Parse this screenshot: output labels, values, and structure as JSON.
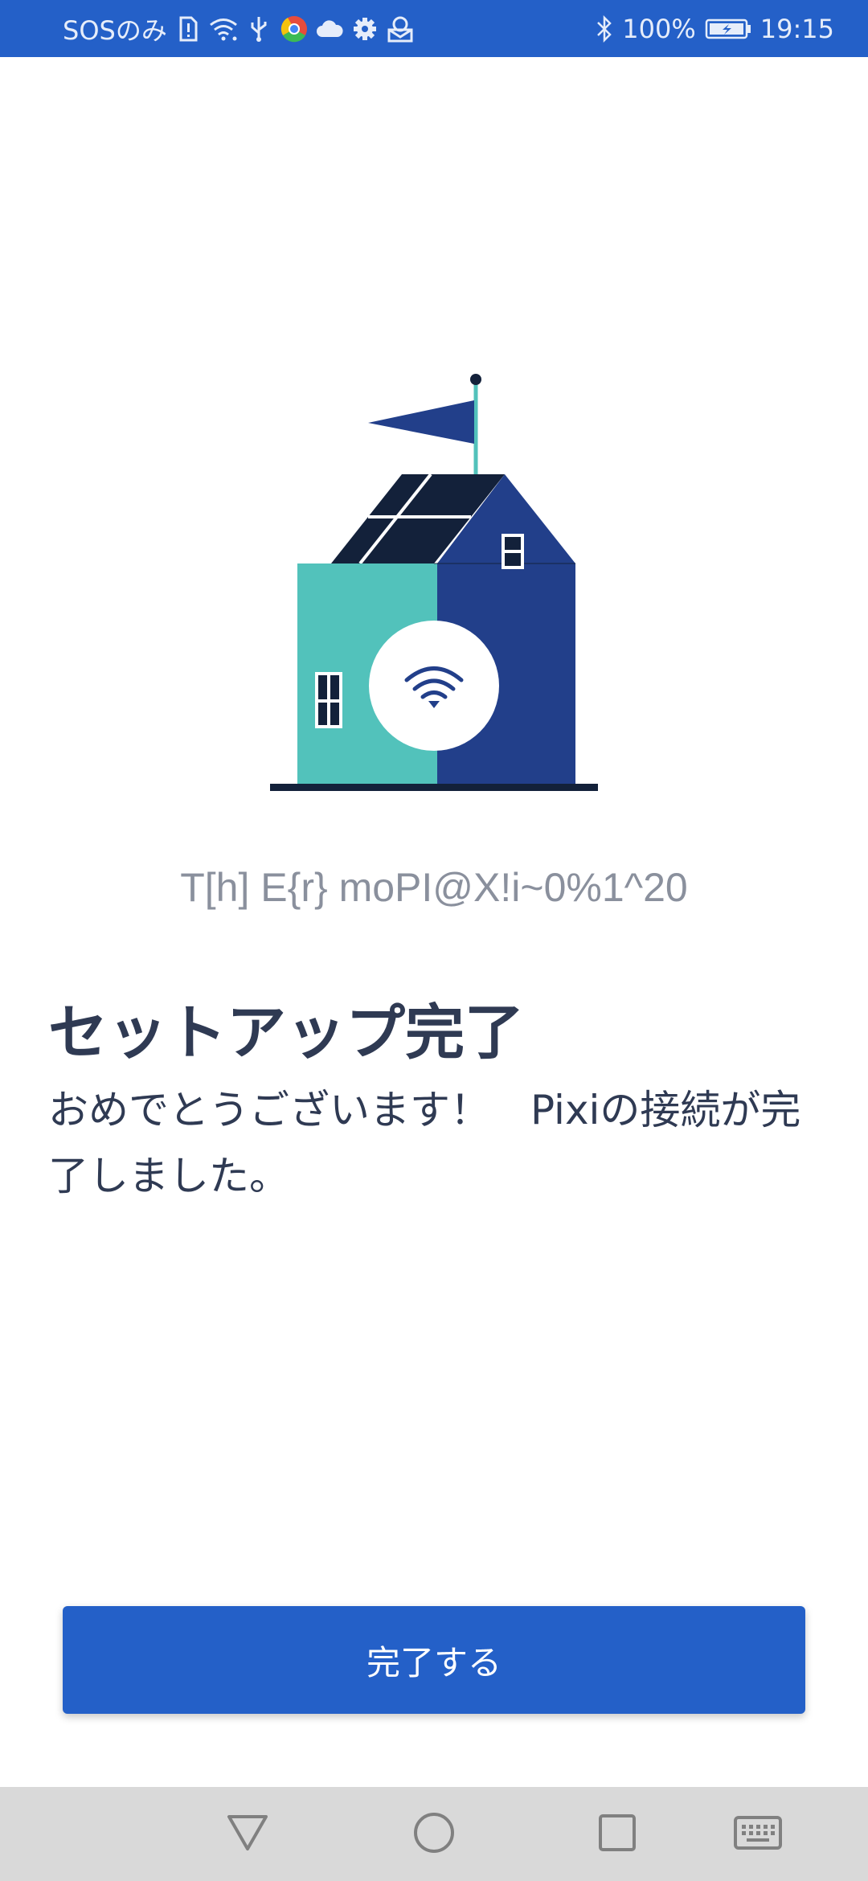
{
  "status_bar": {
    "carrier": "SOSのみ",
    "battery": "100%",
    "time": "19:15",
    "left_icons": [
      "sim-alert-icon",
      "wifi-icon",
      "usb-icon",
      "chrome-icon",
      "cloud-icon",
      "gear-icon",
      "mail-robot-icon"
    ],
    "right_icons": [
      "bluetooth-icon",
      "battery-icon"
    ]
  },
  "illustration": {
    "name": "house-with-wifi",
    "colors": {
      "teal": "#52c2bb",
      "navy": "#223f8a",
      "roof": "#13213a",
      "flag": "#223f8a",
      "flagpole": "#52c2bb"
    }
  },
  "device": {
    "id_text": "T[h] E{r} moPI@X!i~0%1^20"
  },
  "content": {
    "heading": "セットアップ完了",
    "message": "おめでとうございます！　Pixiの接続が完了しました。"
  },
  "actions": {
    "done_label": "完了する"
  },
  "nav_bar": {
    "buttons": [
      "back-icon",
      "home-icon",
      "recents-icon",
      "keyboard-icon"
    ]
  },
  "theme": {
    "accent": "#2460c8",
    "text_dark": "#2f3a53",
    "text_muted": "#8a909d",
    "nav_bg": "#d9d9d9"
  }
}
